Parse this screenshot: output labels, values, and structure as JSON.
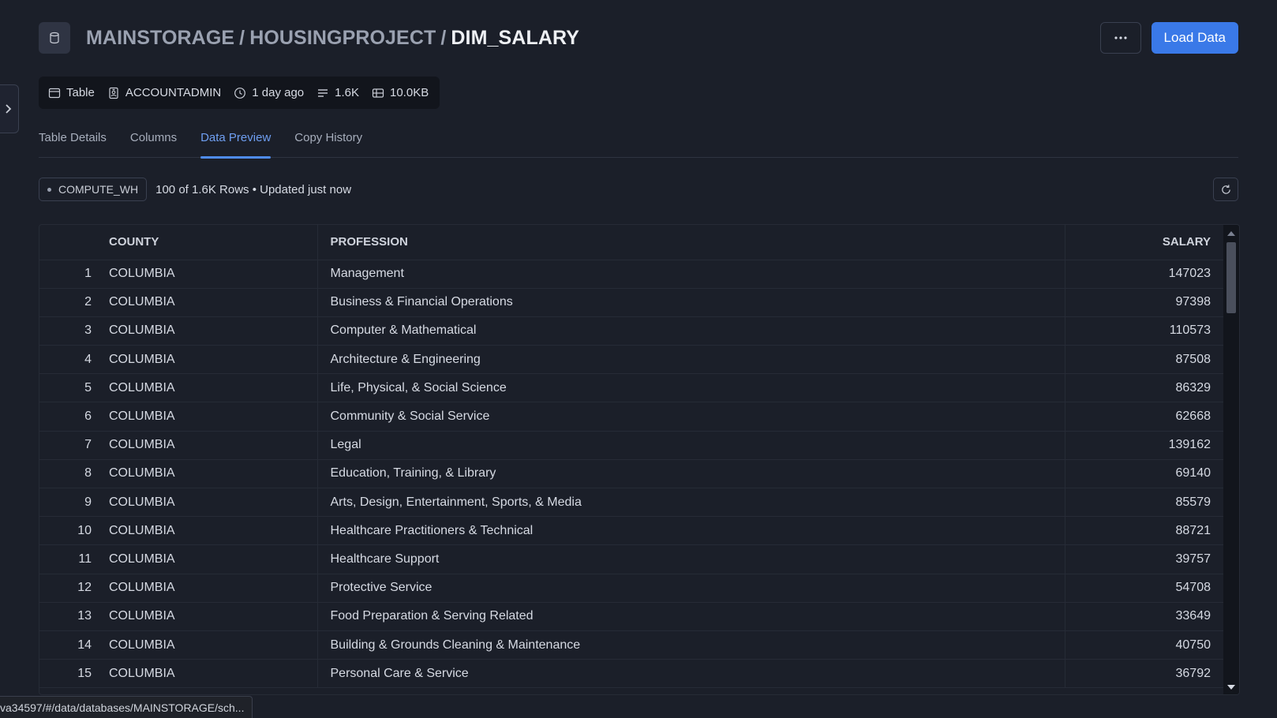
{
  "header": {
    "crumb1": "MAINSTORAGE",
    "crumb2": "HOUSINGPROJECT",
    "separator": "/",
    "current": "DIM_SALARY",
    "more_label": "···",
    "load_label": "Load Data"
  },
  "meta": {
    "type": "Table",
    "owner": "ACCOUNTADMIN",
    "updated": "1 day ago",
    "rows": "1.6K",
    "size": "10.0KB"
  },
  "tabs": [
    {
      "label": "Table Details",
      "active": false
    },
    {
      "label": "Columns",
      "active": false
    },
    {
      "label": "Data Preview",
      "active": true
    },
    {
      "label": "Copy History",
      "active": false
    }
  ],
  "toolbar": {
    "warehouse": "COMPUTE_WH",
    "row_info": "100 of 1.6K Rows • Updated just now"
  },
  "table": {
    "columns": [
      "COUNTY",
      "PROFESSION",
      "SALARY"
    ],
    "rows": [
      {
        "n": "1",
        "county": "COLUMBIA",
        "profession": "Management",
        "salary": "147023"
      },
      {
        "n": "2",
        "county": "COLUMBIA",
        "profession": "Business & Financial Operations",
        "salary": "97398"
      },
      {
        "n": "3",
        "county": "COLUMBIA",
        "profession": "Computer & Mathematical",
        "salary": "110573"
      },
      {
        "n": "4",
        "county": "COLUMBIA",
        "profession": "Architecture & Engineering",
        "salary": "87508"
      },
      {
        "n": "5",
        "county": "COLUMBIA",
        "profession": "Life, Physical, & Social Science",
        "salary": "86329"
      },
      {
        "n": "6",
        "county": "COLUMBIA",
        "profession": "Community & Social Service",
        "salary": "62668"
      },
      {
        "n": "7",
        "county": "COLUMBIA",
        "profession": "Legal",
        "salary": "139162"
      },
      {
        "n": "8",
        "county": "COLUMBIA",
        "profession": "Education, Training, & Library",
        "salary": "69140"
      },
      {
        "n": "9",
        "county": "COLUMBIA",
        "profession": "Arts, Design, Entertainment, Sports, & Media",
        "salary": "85579"
      },
      {
        "n": "10",
        "county": "COLUMBIA",
        "profession": "Healthcare Practitioners & Technical",
        "salary": "88721"
      },
      {
        "n": "11",
        "county": "COLUMBIA",
        "profession": "Healthcare Support",
        "salary": "39757"
      },
      {
        "n": "12",
        "county": "COLUMBIA",
        "profession": "Protective Service",
        "salary": "54708"
      },
      {
        "n": "13",
        "county": "COLUMBIA",
        "profession": "Food Preparation & Serving Related",
        "salary": "33649"
      },
      {
        "n": "14",
        "county": "COLUMBIA",
        "profession": "Building & Grounds Cleaning & Maintenance",
        "salary": "40750"
      },
      {
        "n": "15",
        "county": "COLUMBIA",
        "profession": "Personal Care & Service",
        "salary": "36792"
      }
    ]
  },
  "statusbar": {
    "url": "va34597/#/data/databases/MAINSTORAGE/sch..."
  },
  "icons": {
    "sidebar_toggle": "chevron-right-icon",
    "database": "database-icon",
    "table": "table-icon",
    "owner": "user-badge-icon",
    "clock": "clock-icon",
    "rows": "rows-icon",
    "size": "storage-icon",
    "refresh": "refresh-icon"
  },
  "colors": {
    "background": "#1b1f29",
    "accent": "#3a79e8",
    "active_tab": "#6f9ff2"
  }
}
